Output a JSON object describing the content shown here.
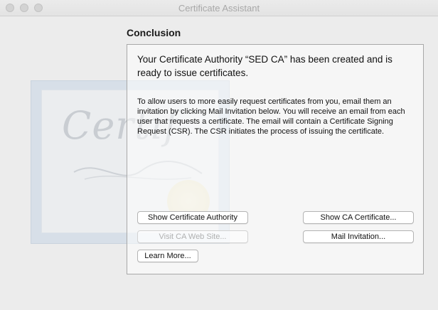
{
  "window": {
    "title": "Certificate Assistant"
  },
  "background_art": {
    "word": "Certif"
  },
  "page": {
    "heading": "Conclusion"
  },
  "message": {
    "headline": "Your Certificate Authority “SED CA” has been created and is ready to issue certificates.",
    "body": "To allow users to more easily request certificates from you, email them an invitation by clicking Mail Invitation below. You will receive an email from each user that requests a certificate. The email will contain a Certificate Signing Request (CSR). The CSR initiates the process of issuing the certificate."
  },
  "buttons": {
    "show_ca": "Show Certificate Authority",
    "show_ca_cert": "Show CA Certificate...",
    "visit_web": "Visit CA Web Site...",
    "mail_invitation": "Mail Invitation...",
    "learn_more": "Learn More..."
  }
}
